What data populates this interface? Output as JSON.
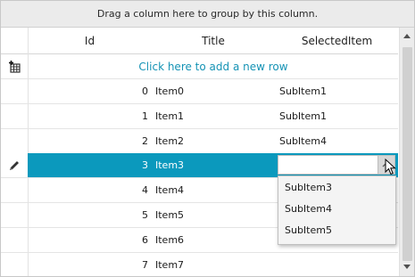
{
  "group_panel": {
    "text": "Drag a column here to group by this column."
  },
  "columns": {
    "id": "Id",
    "title": "Title",
    "selected_item": "SelectedItem"
  },
  "add_row_text": "Click here to add a new row",
  "rows": [
    {
      "id": "0",
      "title": "Item0",
      "selected_item": "SubItem1"
    },
    {
      "id": "1",
      "title": "Item1",
      "selected_item": "SubItem1"
    },
    {
      "id": "2",
      "title": "Item2",
      "selected_item": "SubItem4"
    },
    {
      "id": "3",
      "title": "Item3",
      "selected_item": ""
    },
    {
      "id": "4",
      "title": "Item4",
      "selected_item": ""
    },
    {
      "id": "5",
      "title": "Item5",
      "selected_item": ""
    },
    {
      "id": "6",
      "title": "Item6",
      "selected_item": ""
    },
    {
      "id": "7",
      "title": "Item7",
      "selected_item": ""
    }
  ],
  "dropdown": {
    "options": [
      "SubItem3",
      "SubItem4",
      "SubItem5"
    ]
  },
  "colors": {
    "selected_row": "#0b99bd",
    "link": "#1593b5"
  },
  "icons": {
    "add_row": "add-row-grid-icon",
    "edit": "pencil-icon",
    "dropdown_arrow": "chevron-up-icon"
  }
}
